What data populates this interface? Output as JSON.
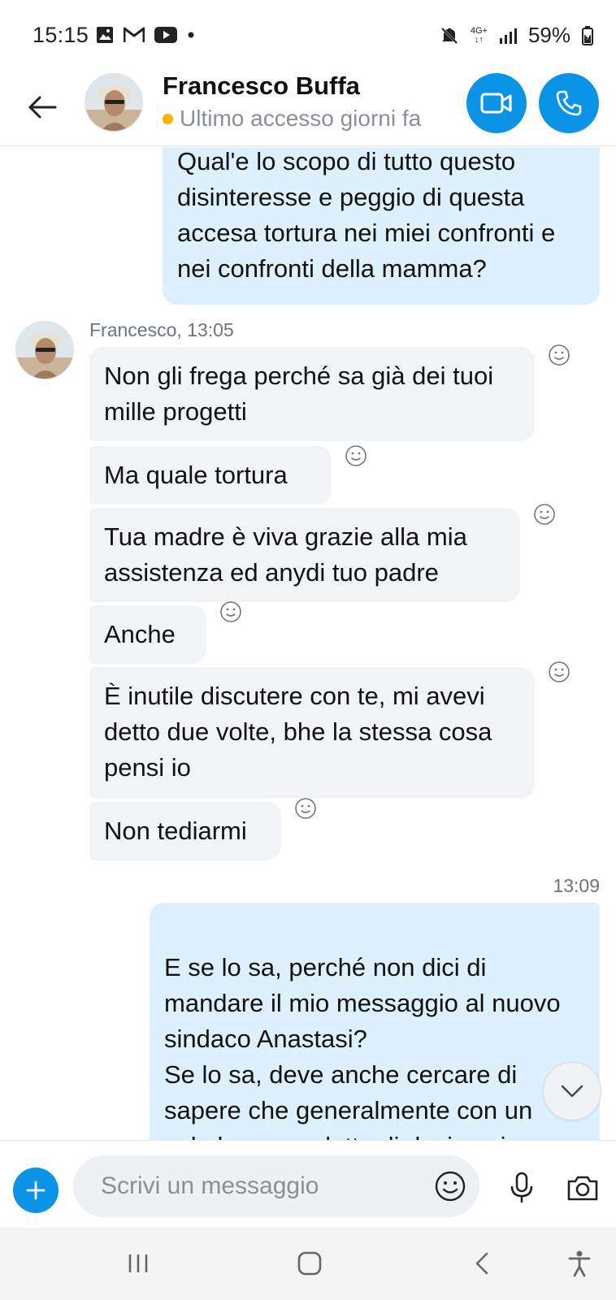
{
  "status_bar": {
    "time": "15:15",
    "network": "4G+",
    "battery": "59%",
    "icons": [
      "image-icon",
      "gmail-icon",
      "youtube-icon",
      "dot-icon",
      "mute-icon",
      "signal-icon",
      "battery-icon"
    ]
  },
  "header": {
    "contact_name": "Francesco Buffa",
    "presence": "Ultimo accesso giorni fa",
    "presence_color": "#f7b500",
    "accent": "#0b93e6"
  },
  "messages": {
    "outgoing_1": "Qual'e lo scopo di tutto questo disinteresse e peggio di questa accesa tortura nei miei confronti e nei confronti della mamma?",
    "incoming_group": {
      "sender": "Francesco, 13:05",
      "items": [
        "Non gli frega perché sa già dei tuoi mille progetti",
        "Ma quale tortura",
        "Tua madre è viva grazie alla mia assistenza ed anydi tuo padre",
        "Anche",
        "È inutile discutere con te, mi avevi detto due volte, bhe la stessa cosa pensi io",
        "Non tediarmi"
      ]
    },
    "outgoing_2_time": "13:09",
    "outgoing_2": "E se lo sa, perché non dici di mandare il mio messaggio al nuovo sindaco Anastasi?\nSe lo sa, deve anche cercare di sapere che generalmente con un solo buon prodotto di design si apre un'azienda, e deve sapere"
  },
  "composer": {
    "placeholder": "Scrivi un messaggio"
  }
}
